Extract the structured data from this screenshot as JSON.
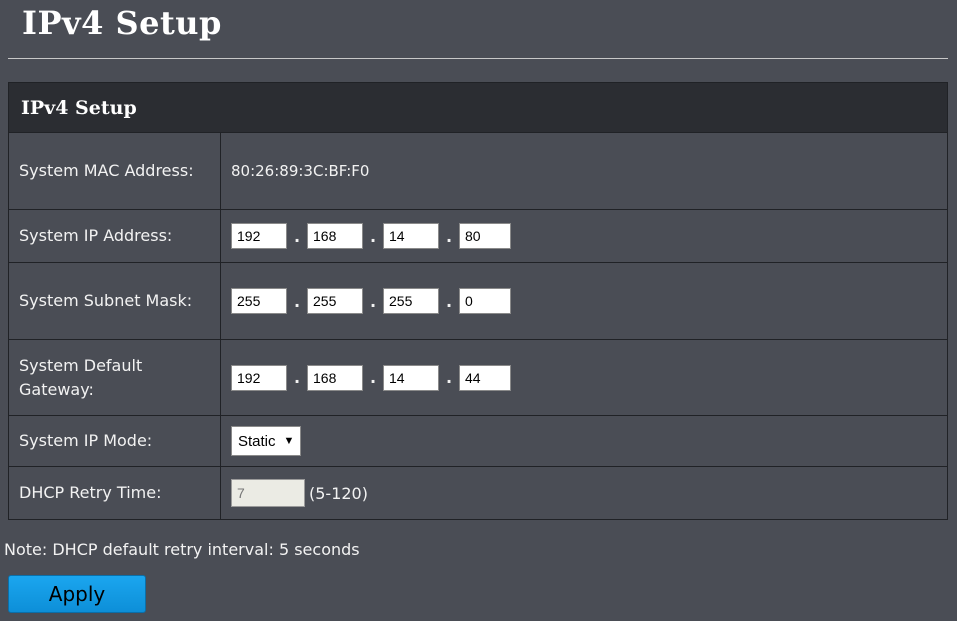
{
  "page": {
    "title": "IPv4 Setup"
  },
  "panel": {
    "header": "IPv4 Setup"
  },
  "rows": {
    "mac": {
      "label": "System MAC Address:",
      "value": "80:26:89:3C:BF:F0"
    },
    "ip": {
      "label": "System IP Address:",
      "octets": [
        "192",
        "168",
        "14",
        "80"
      ]
    },
    "mask": {
      "label": "System Subnet Mask:",
      "octets": [
        "255",
        "255",
        "255",
        "0"
      ]
    },
    "gateway": {
      "label": "System Default Gateway:",
      "octets": [
        "192",
        "168",
        "14",
        "44"
      ]
    },
    "mode": {
      "label": "System IP Mode:",
      "selected": "Static"
    },
    "dhcp": {
      "label": "DHCP Retry Time:",
      "value": "7",
      "range": "(5-120)"
    }
  },
  "note": "Note: DHCP default retry interval: 5 seconds",
  "apply_label": "Apply",
  "icons": {
    "select_arrow": "dropdown-arrow-icon"
  },
  "colors": {
    "background": "#4a4d55",
    "header": "#2b2d32",
    "accent": "#1ba6ef"
  }
}
